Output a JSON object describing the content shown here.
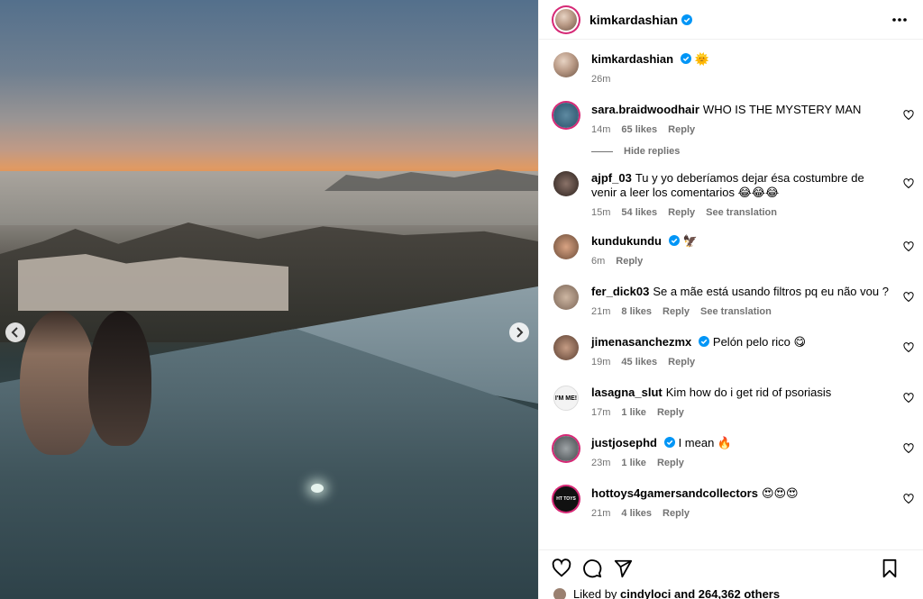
{
  "post": {
    "author": "kimkardashian",
    "verified": true,
    "caption_emoji": "🌞",
    "time": "26m"
  },
  "comments": [
    {
      "user": "sara.braidwoodhair",
      "text": "WHO IS THE MYSTERY MAN",
      "time": "14m",
      "likes": "65 likes",
      "reply": "Reply",
      "verified": false
    },
    {
      "user": "ajpf_03",
      "text": "Tu y yo deberíamos dejar ésa costumbre de venir a leer los comentarios 😂😂😂",
      "time": "15m",
      "likes": "54 likes",
      "reply": "Reply",
      "translation": "See translation",
      "verified": false
    },
    {
      "user": "kundukundu",
      "text": "🦅",
      "time": "6m",
      "likes": "",
      "reply": "Reply",
      "verified": true
    },
    {
      "user": "fer_dick03",
      "text": "Se a mãe está usando filtros pq eu não vou ?",
      "time": "21m",
      "likes": "8 likes",
      "reply": "Reply",
      "translation": "See translation",
      "verified": false
    },
    {
      "user": "jimenasanchezmx",
      "text": "Pelón pelo rico 😋",
      "time": "19m",
      "likes": "45 likes",
      "reply": "Reply",
      "verified": true
    },
    {
      "user": "lasagna_slut",
      "text": "Kim how do i get rid of psoriasis",
      "time": "17m",
      "likes": "1 like",
      "reply": "Reply",
      "verified": false,
      "avatar_text": "I'M ME!"
    },
    {
      "user": "justjosephd",
      "text": "I mean 🔥",
      "time": "23m",
      "likes": "1 like",
      "reply": "Reply",
      "verified": true
    },
    {
      "user": "hottoys4gamersandcollectors",
      "text": "😍😍😍",
      "time": "21m",
      "likes": "4 likes",
      "reply": "Reply",
      "verified": false,
      "avatar_text": "HT TOYS"
    }
  ],
  "hide_replies": "Hide replies",
  "liked_by": {
    "prefix": "Liked by",
    "user": "cindyloci",
    "suffix": "and 264,362 others"
  },
  "colors": {
    "verified": "#0095f6",
    "meta": "#737373",
    "ring": "#d62976"
  }
}
